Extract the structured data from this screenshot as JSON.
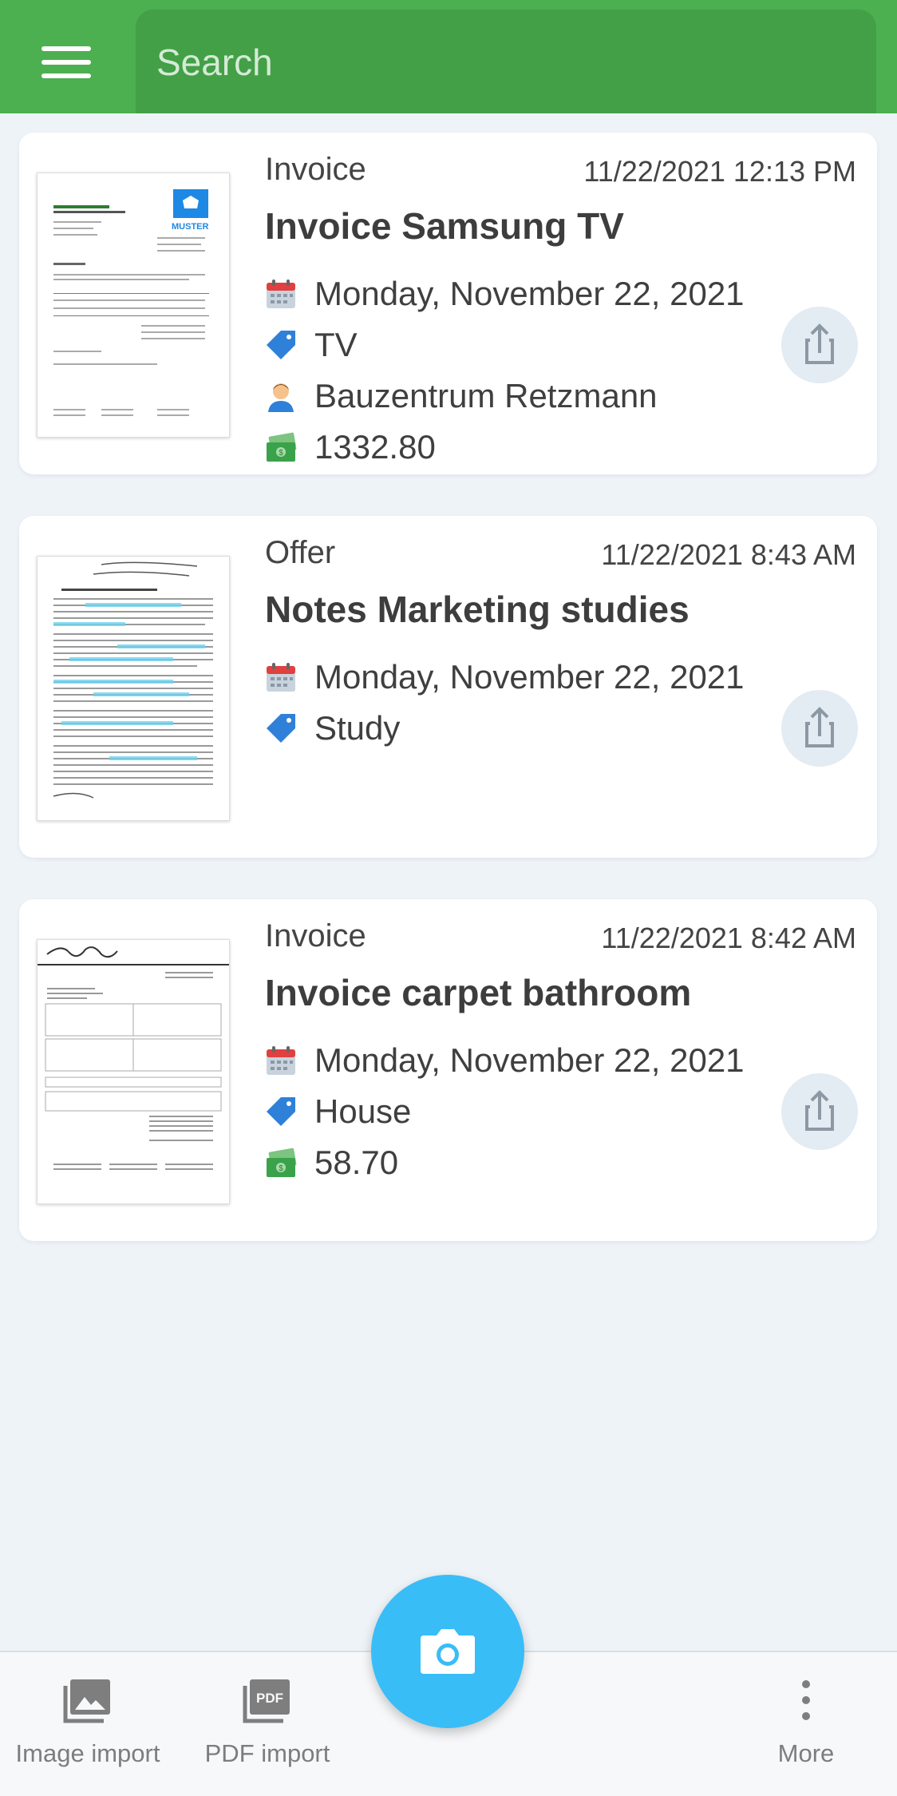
{
  "header": {
    "search_placeholder": "Search",
    "color": "#4caf50"
  },
  "documents": [
    {
      "type": "Invoice",
      "datetime": "11/22/2021 12:13 PM",
      "title": "Invoice Samsung TV",
      "date": "Monday, November 22, 2021",
      "tag": "TV",
      "contact": "Bauzentrum Retzmann",
      "amount": "1332.80",
      "thumb_logo_text": "MUSTER"
    },
    {
      "type": "Offer",
      "datetime": "11/22/2021 8:43 AM",
      "title": "Notes Marketing studies",
      "date": "Monday, November 22, 2021",
      "tag": "Study"
    },
    {
      "type": "Invoice",
      "datetime": "11/22/2021 8:42 AM",
      "title": "Invoice carpet bathroom",
      "date": "Monday, November 22, 2021",
      "tag": "House",
      "amount": "58.70"
    }
  ],
  "bottom_bar": {
    "image_import": "Image import",
    "pdf_import": "PDF import",
    "pdf_badge": "PDF",
    "more": "More"
  },
  "colors": {
    "fab": "#39bdf7",
    "header": "#4caf50",
    "tag": "#2f80d8",
    "money": "#3aa24a"
  }
}
